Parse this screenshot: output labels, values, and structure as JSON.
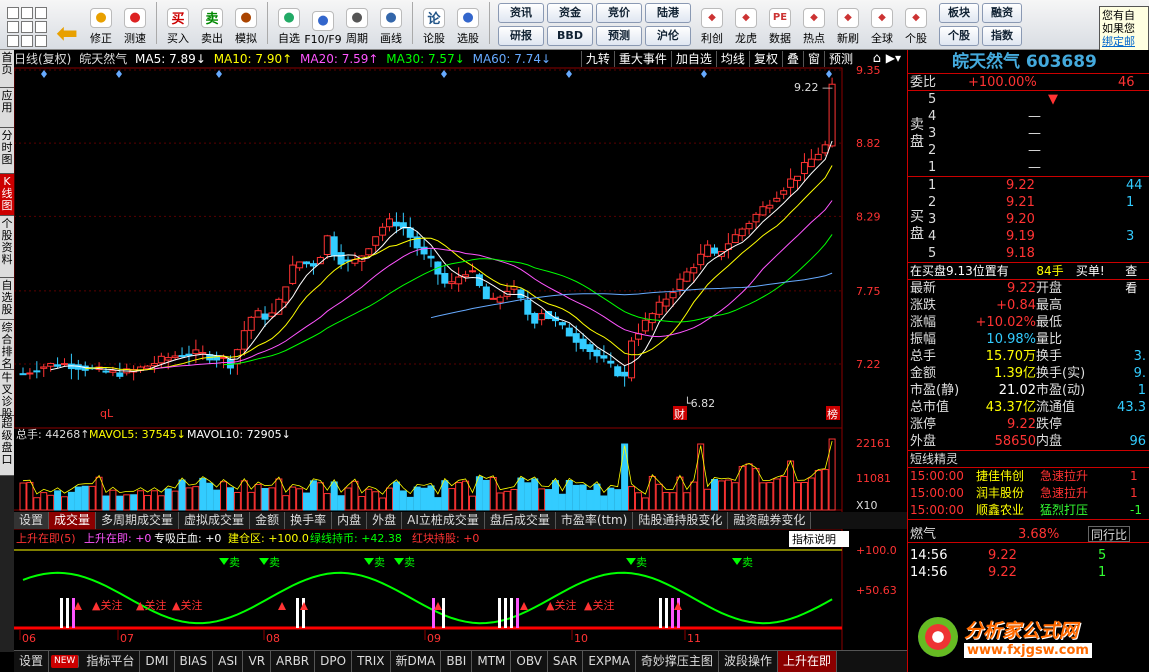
{
  "toolbar": {
    "buttons": [
      {
        "label": "修正",
        "icon": "up-down-arrow-icon"
      },
      {
        "label": "测速",
        "icon": "stopwatch-icon"
      },
      {
        "label": "买入",
        "icon": "buy-icon",
        "glyph": "买"
      },
      {
        "label": "卖出",
        "icon": "sell-icon",
        "glyph": "卖"
      },
      {
        "label": "模拟",
        "icon": "hammer-icon"
      },
      {
        "label": "自选",
        "icon": "watchlist-icon"
      },
      {
        "label": "F10/F9",
        "icon": "f10-icon"
      },
      {
        "label": "周期",
        "icon": "period-icon"
      },
      {
        "label": "画线",
        "icon": "pencil-icon"
      },
      {
        "label": "论股",
        "icon": "discuss-icon",
        "glyph": "论"
      },
      {
        "label": "选股",
        "icon": "select-stock-icon"
      }
    ],
    "grid_buttons": [
      "资讯",
      "资金",
      "竞价",
      "陆港",
      "研报",
      "BBD",
      "预测",
      "沪伦"
    ],
    "right_buttons": [
      {
        "label": "利创",
        "icon": "lichuang-icon"
      },
      {
        "label": "龙虎",
        "icon": "dragon-tiger-icon"
      },
      {
        "label": "数据",
        "icon": "data-pe-icon",
        "glyph": "PE"
      },
      {
        "label": "热点",
        "icon": "hot-icon"
      },
      {
        "label": "新刷",
        "icon": "new-icon"
      },
      {
        "label": "全球",
        "icon": "globe-icon"
      },
      {
        "label": "个股",
        "icon": "stock-icon"
      }
    ],
    "small_right": [
      "板块",
      "融资",
      "个股",
      "指数"
    ],
    "back_arrow": "back-arrow-icon"
  },
  "tooltip": {
    "line1": "您有自",
    "line2": "如果您",
    "line3": "绑定邮"
  },
  "left_tabs": [
    "首页",
    "应用",
    "分时图",
    "K线图",
    "个股资料",
    "自选股",
    "综合排名",
    "牛叉诊股",
    "超级盘口"
  ],
  "ma_bar": {
    "period": "日线(复权)",
    "name": "皖天然气",
    "ma5": "MA5: 7.89↓",
    "ma10": "MA10: 7.90↑",
    "ma20": "MA20: 7.59↑",
    "ma30": "MA30: 7.57↓",
    "ma60": "MA60: 7.74↓"
  },
  "chart_buttons": [
    "九转",
    "重大事件",
    "加自选",
    "均线",
    "复权",
    "叠",
    "窗",
    "预测"
  ],
  "price_axis": [
    "9.35",
    "8.82",
    "8.29",
    "7.75",
    "7.22"
  ],
  "price_high_label": "9.22",
  "price_low_label": "6.82",
  "markers": {
    "cai": "财",
    "bang": "榜",
    "ql": "qL"
  },
  "vol_bar": {
    "total": "总手: 44268↑",
    "mavol5": "MAVOL5: 37545↓",
    "mavol10": "MAVOL10: 72905↓"
  },
  "vol_axis": [
    "22161",
    "11081",
    "X10"
  ],
  "indicator_tabs": [
    "设置",
    "成交量",
    "多周期成交量",
    "虚拟成交量",
    "金额",
    "换手率",
    "内盘",
    "外盘",
    "AI立桩成交量",
    "盘后成交量",
    "市盈率(ttm)",
    "陆股通持股变化",
    "融资融券变化"
  ],
  "signal_bar": {
    "title": "上升在即(5)",
    "t1": "上升在即: +0",
    "t2": "专吸庄血: +0",
    "t3": "建仓区: +100.0",
    "t4": "绿线持币: +42.38",
    "t5": "红块持股: +0",
    "help": "指标说明"
  },
  "signal_axis": [
    "+100.0",
    "+50.63"
  ],
  "sell_label": "卖",
  "attention_label": "▲关注",
  "date_axis": [
    "06",
    "07",
    "08",
    "09",
    "10",
    "11"
  ],
  "bottom_tabs": [
    "设置",
    "NEW",
    "指标平台",
    "DMI",
    "BIAS",
    "ASI",
    "VR",
    "ARBR",
    "DPO",
    "TRIX",
    "新DMA",
    "BBI",
    "MTM",
    "OBV",
    "SAR",
    "EXPMA",
    "奇妙撑压主图",
    "波段操作",
    "上升在即"
  ],
  "right_panel": {
    "stock_title": "皖天然气 603689",
    "weibi": {
      "label": "委比",
      "value": "+100.00%",
      "extra": "46"
    },
    "sell_label": "卖盘",
    "buy_label": "买盘",
    "asks": [
      {
        "lvl": "5",
        "price": "",
        "vol": "",
        "lead": "5"
      },
      {
        "lvl": "4",
        "price": "—",
        "vol": ""
      },
      {
        "lvl": "3",
        "price": "—",
        "vol": ""
      },
      {
        "lvl": "2",
        "price": "—",
        "vol": ""
      },
      {
        "lvl": "1",
        "price": "—",
        "vol": ""
      }
    ],
    "bids": [
      {
        "lvl": "1",
        "price": "9.22",
        "vol": "44"
      },
      {
        "lvl": "2",
        "price": "9.21",
        "vol": "1"
      },
      {
        "lvl": "3",
        "price": "9.20",
        "vol": ""
      },
      {
        "lvl": "4",
        "price": "9.19",
        "vol": "3"
      },
      {
        "lvl": "5",
        "price": "9.18",
        "vol": ""
      }
    ],
    "zaimai": {
      "text": "在买盘9.13位置有",
      "vol": "84手",
      "buy": "买单!",
      "view": "查看"
    },
    "quote": [
      {
        "l1": "最新",
        "v1": "9.22",
        "c1": "red",
        "l2": "开盘",
        "v2": ""
      },
      {
        "l1": "涨跌",
        "v1": "+0.84",
        "c1": "red",
        "l2": "最高",
        "v2": ""
      },
      {
        "l1": "涨幅",
        "v1": "+10.02%",
        "c1": "red",
        "l2": "最低",
        "v2": ""
      },
      {
        "l1": "振幅",
        "v1": "10.98%",
        "c1": "cyn",
        "l2": "量比",
        "v2": ""
      },
      {
        "l1": "总手",
        "v1": "15.70万",
        "c1": "yel",
        "l2": "换手",
        "v2": "3."
      },
      {
        "l1": "金额",
        "v1": "1.39亿",
        "c1": "yel",
        "l2": "换手(实)",
        "v2": "9."
      },
      {
        "l1": "市盈(静)",
        "v1": "21.02",
        "c1": "wht",
        "l2": "市盈(动)",
        "v2": "1"
      },
      {
        "l1": "总市值",
        "v1": "43.37亿",
        "c1": "yel",
        "l2": "流通值",
        "v2": "43.3"
      },
      {
        "l1": "涨停",
        "v1": "9.22",
        "c1": "red",
        "l2": "跌停",
        "v2": ""
      },
      {
        "l1": "外盘",
        "v1": "58650",
        "c1": "red",
        "l2": "内盘",
        "v2": "96"
      }
    ],
    "short_title": "短线精灵",
    "short_items": [
      {
        "time": "15:00:00",
        "name": "捷佳伟创",
        "event": "急速拉升",
        "val": "1"
      },
      {
        "time": "15:00:00",
        "name": "润丰股份",
        "event": "急速拉升",
        "val": "1"
      },
      {
        "time": "15:00:00",
        "name": "顺鑫农业",
        "event": "猛烈打压",
        "val": "-1"
      }
    ],
    "sector": {
      "name": "燃气",
      "pct": "3.68%",
      "tab": "同行比"
    },
    "ticks": [
      {
        "time": "14:56",
        "price": "9.22",
        "vol": "5"
      },
      {
        "time": "14:56",
        "price": "9.22",
        "vol": "1"
      }
    ]
  },
  "logo": {
    "t1": "分析家公式网",
    "t2": "www.fxjgsw.com"
  },
  "colors": {
    "up": "#ff3333",
    "down": "#3cf",
    "ma5": "#ffffff",
    "ma10": "#ffff00",
    "ma20": "#ff55ff",
    "ma30": "#00ff00",
    "ma60": "#66aaff"
  }
}
